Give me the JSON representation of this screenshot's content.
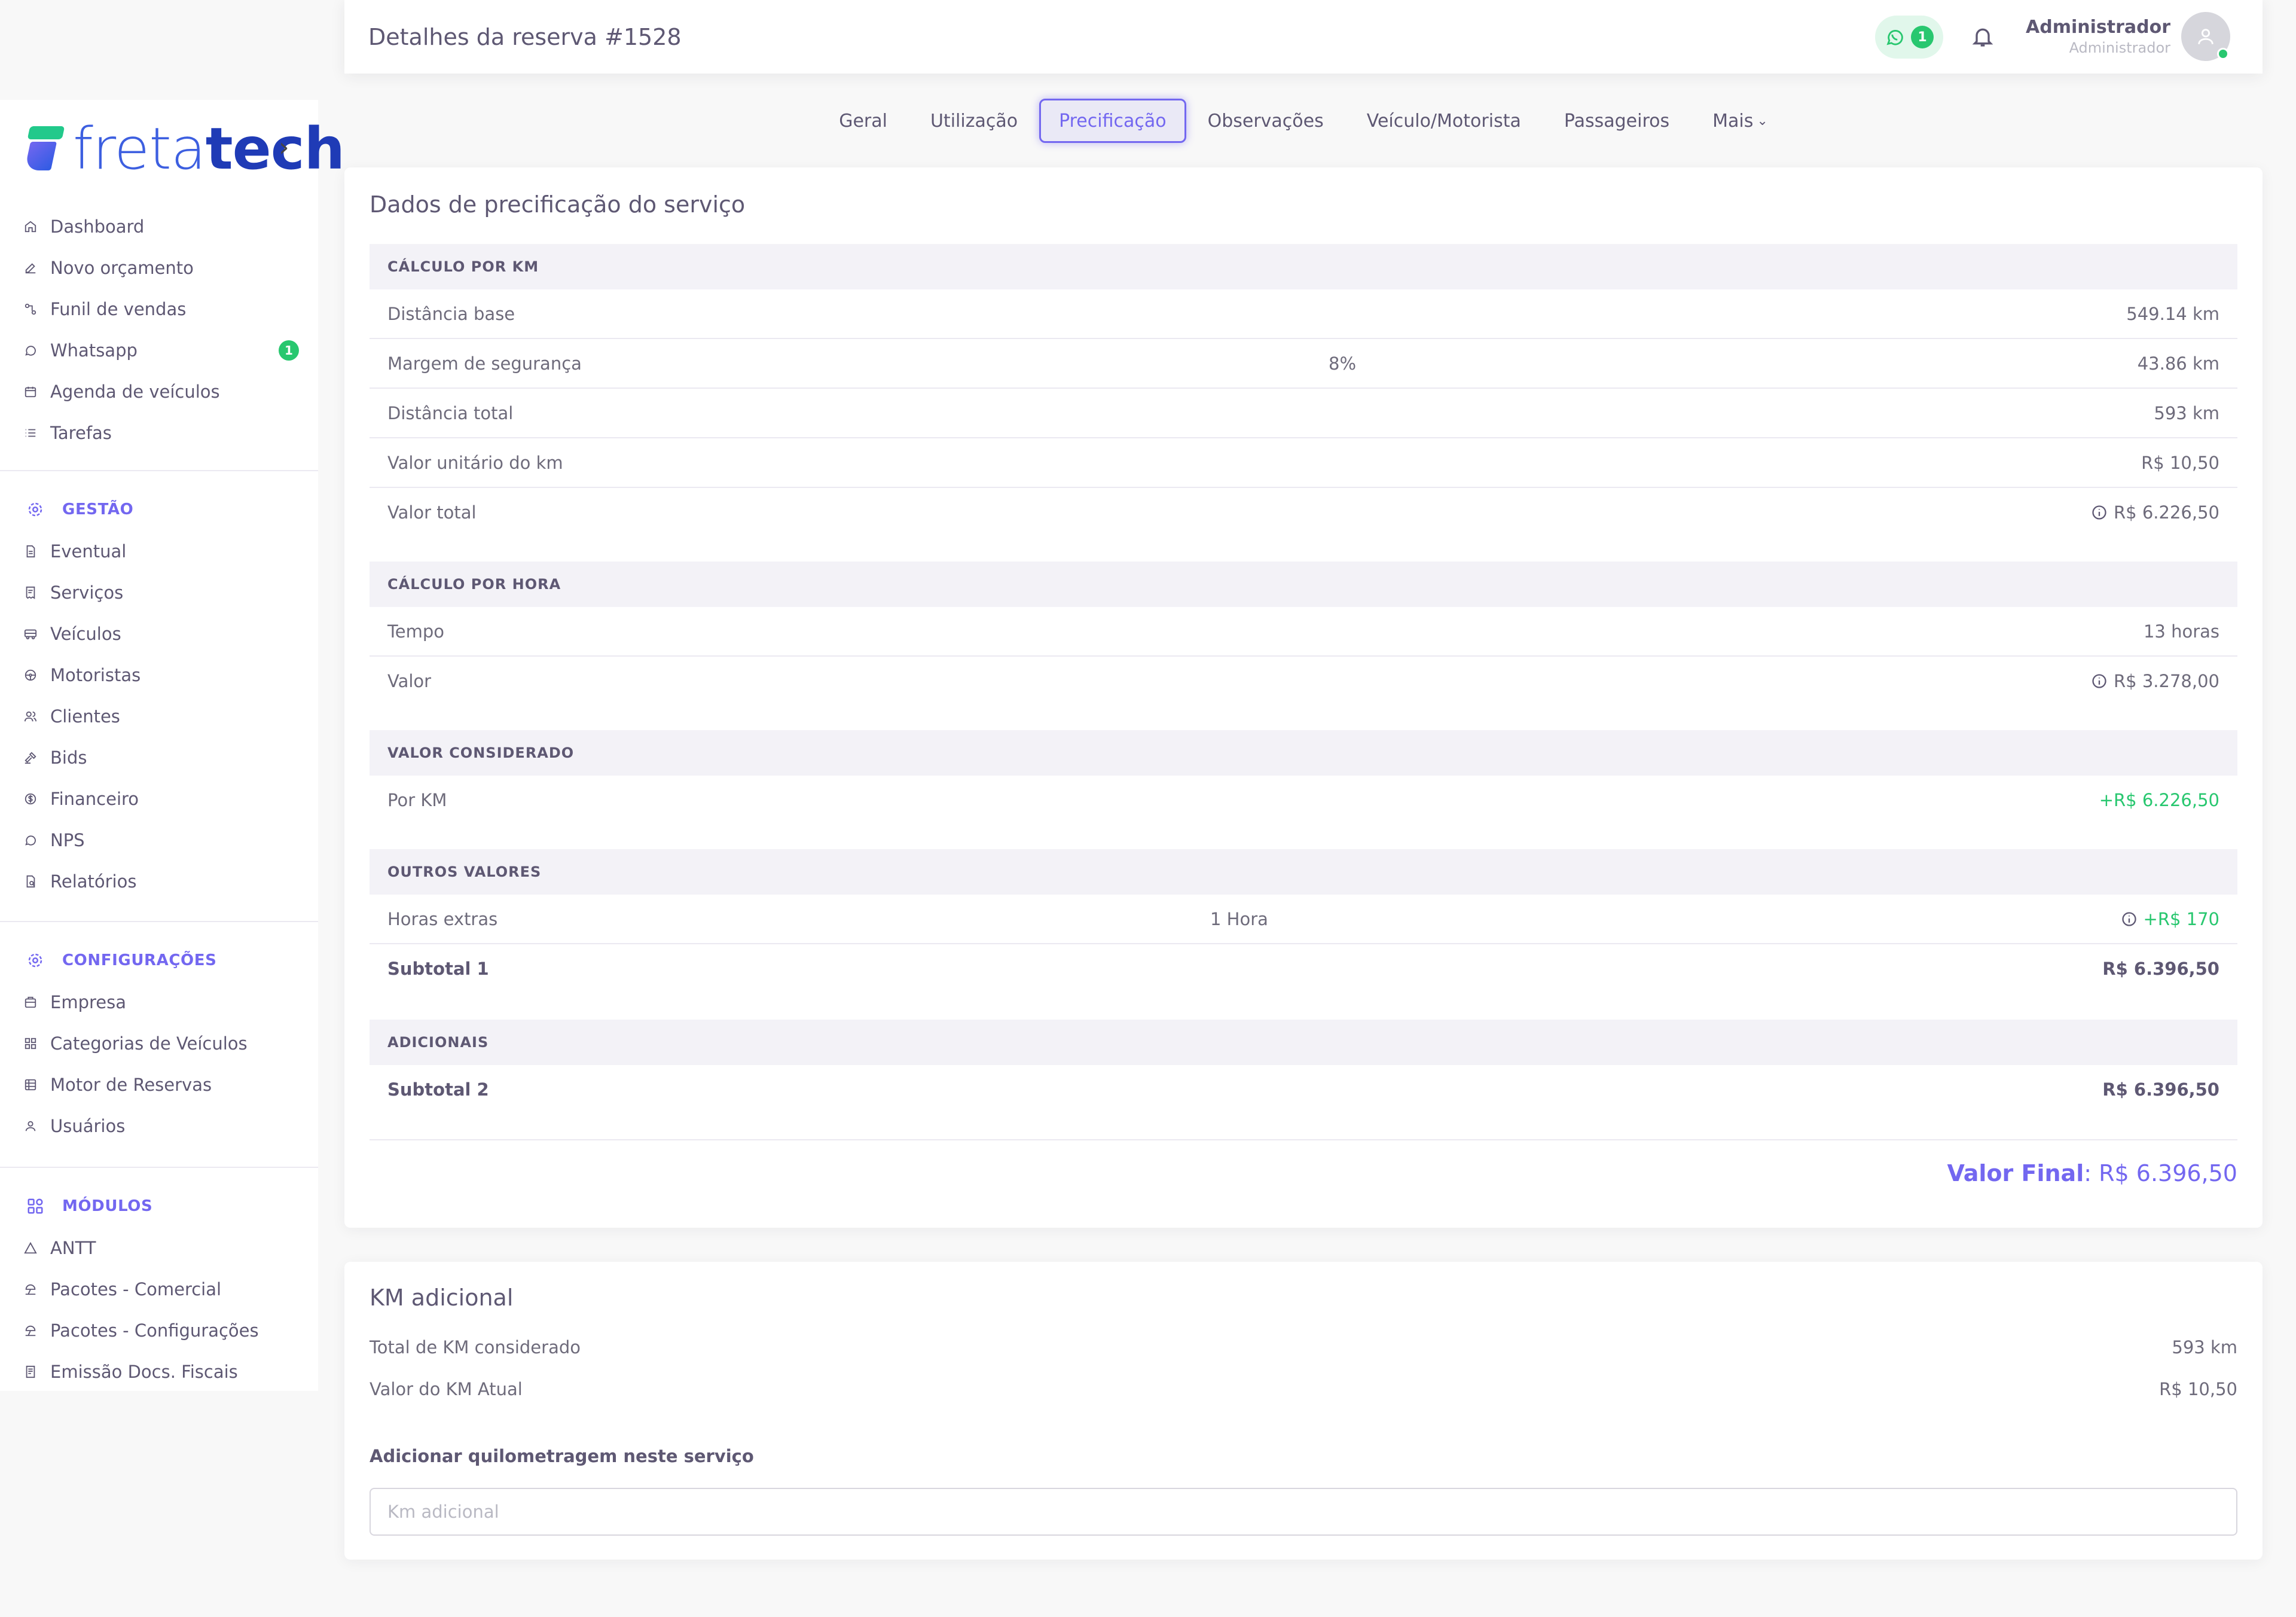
{
  "header": {
    "title": "Detalhes da reserva #1528",
    "whatsapp_count": "1",
    "user_name": "Administrador",
    "user_role": "Administrador"
  },
  "logo": {
    "text_light": "freta",
    "text_bold": "tech"
  },
  "sidebar": {
    "main_items": [
      {
        "label": "Dashboard",
        "icon": "home-icon"
      },
      {
        "label": "Novo orçamento",
        "icon": "edit-icon"
      },
      {
        "label": "Funil de vendas",
        "icon": "funnel-icon"
      },
      {
        "label": "Whatsapp",
        "icon": "whatsapp-icon",
        "badge": "1"
      },
      {
        "label": "Agenda de veículos",
        "icon": "calendar-icon"
      },
      {
        "label": "Tarefas",
        "icon": "list-icon"
      }
    ],
    "gestao_title": "GESTÃO",
    "gestao_items": [
      {
        "label": "Eventual",
        "icon": "document-icon"
      },
      {
        "label": "Serviços",
        "icon": "receipt-icon"
      },
      {
        "label": "Veículos",
        "icon": "bus-icon"
      },
      {
        "label": "Motoristas",
        "icon": "steering-wheel-icon"
      },
      {
        "label": "Clientes",
        "icon": "users-icon"
      },
      {
        "label": "Bids",
        "icon": "gavel-icon"
      },
      {
        "label": "Financeiro",
        "icon": "dollar-icon"
      },
      {
        "label": "NPS",
        "icon": "chat-icon"
      },
      {
        "label": "Relatórios",
        "icon": "report-icon"
      }
    ],
    "config_title": "CONFIGURAÇÕES",
    "config_items": [
      {
        "label": "Empresa",
        "icon": "building-icon"
      },
      {
        "label": "Categorias de Veículos",
        "icon": "grid-icon"
      },
      {
        "label": "Motor de Reservas",
        "icon": "table-icon"
      },
      {
        "label": "Usuários",
        "icon": "user-icon"
      }
    ],
    "modulos_title": "MÓDULOS",
    "modulos_items": [
      {
        "label": "ANTT",
        "icon": "triangle-icon"
      },
      {
        "label": "Pacotes - Comercial",
        "icon": "beach-icon"
      },
      {
        "label": "Pacotes - Configurações",
        "icon": "beach-icon"
      },
      {
        "label": "Emissão Docs. Fiscais",
        "icon": "invoice-icon"
      }
    ]
  },
  "tabs": [
    {
      "label": "Geral",
      "active": false
    },
    {
      "label": "Utilização",
      "active": false
    },
    {
      "label": "Precificação",
      "active": true
    },
    {
      "label": "Observações",
      "active": false
    },
    {
      "label": "Veículo/Motorista",
      "active": false
    },
    {
      "label": "Passageiros",
      "active": false
    },
    {
      "label": "Mais",
      "active": false
    }
  ],
  "pricing": {
    "title": "Dados de precificação do serviço",
    "km": {
      "header": "CÁLCULO POR KM",
      "distancia_base": {
        "label": "Distância base",
        "value": "549.14 km"
      },
      "margem": {
        "label": "Margem de segurança",
        "percent": "8%",
        "value": "43.86 km"
      },
      "distancia_total": {
        "label": "Distância total",
        "value": "593 km"
      },
      "valor_unitario": {
        "label": "Valor unitário do km",
        "value": "R$ 10,50"
      },
      "valor_total": {
        "label": "Valor total",
        "value": "R$ 6.226,50"
      }
    },
    "hora": {
      "header": "CÁLCULO POR HORA",
      "tempo": {
        "label": "Tempo",
        "value": "13 horas"
      },
      "valor": {
        "label": "Valor",
        "value": "R$ 3.278,00"
      }
    },
    "considerado": {
      "header": "VALOR CONSIDERADO",
      "por_km": {
        "label": "Por KM",
        "value": "+R$ 6.226,50"
      }
    },
    "outros": {
      "header": "OUTROS VALORES",
      "horas_extras": {
        "label": "Horas extras",
        "qty": "1 Hora",
        "value": "+R$ 170"
      },
      "subtotal1": {
        "label": "Subtotal 1",
        "value": "R$ 6.396,50"
      }
    },
    "adicionais": {
      "header": "ADICIONAIS",
      "subtotal2": {
        "label": "Subtotal 2",
        "value": "R$ 6.396,50"
      }
    },
    "final": {
      "label": "Valor Final",
      "value": "R$ 6.396,50"
    }
  },
  "km_adicional": {
    "title": "KM adicional",
    "total_label": "Total de KM considerado",
    "total_value": "593 km",
    "atual_label": "Valor do KM Atual",
    "atual_value": "R$ 10,50",
    "add_label": "Adicionar quilometragem neste serviço",
    "input_placeholder": "Km adicional"
  },
  "colors": {
    "accent": "#7367f0",
    "success": "#28c76f",
    "text": "#6e6b7b",
    "heading": "#5e5873",
    "background": "#f8f8f8"
  }
}
